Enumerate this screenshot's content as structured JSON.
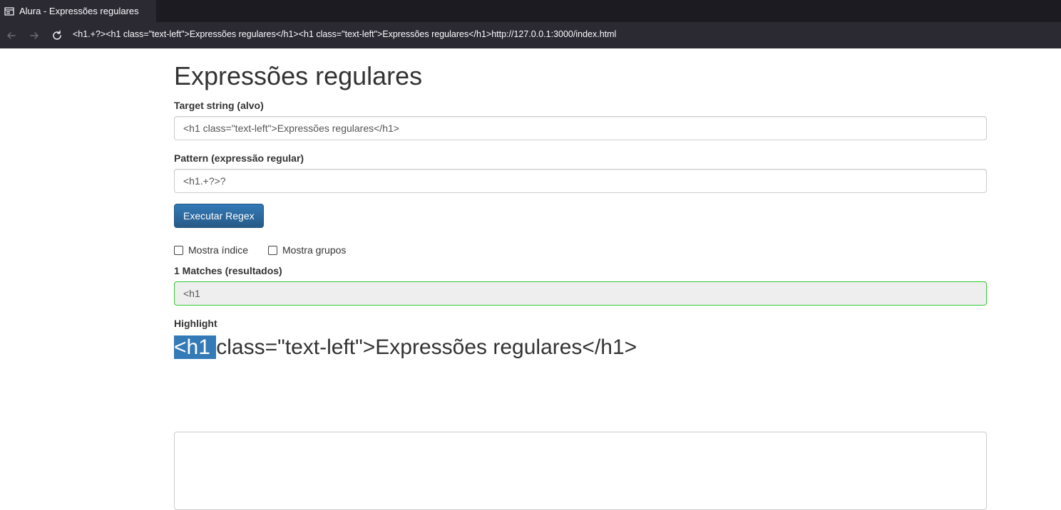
{
  "browser": {
    "tab_title": "Alura - Expressões regulares",
    "url": "<h1.+?><h1 class=\"text-left\">Expressões regulares</h1><h1 class=\"text-left\">Expressões regulares</h1>http://127.0.0.1:3000/index.html"
  },
  "page": {
    "title": "Expressões regulares",
    "target": {
      "label": "Target string (alvo)",
      "value": "<h1 class=\"text-left\">Expressões regulares</h1>"
    },
    "pattern": {
      "label": "Pattern (expressão regular)",
      "value": "<h1.+?>?"
    },
    "execute_button": "Executar Regex",
    "checkboxes": {
      "index_label": "Mostra índice",
      "index_checked": false,
      "groups_label": "Mostra grupos",
      "groups_checked": false
    },
    "matches": {
      "label": "1 Matches (resultados)",
      "value": "<h1"
    },
    "highlight": {
      "label": "Highlight",
      "match_text": "<h1 ",
      "rest_text": "class=\"text-left\">Expressões regulares</h1>"
    },
    "output_text": ""
  }
}
